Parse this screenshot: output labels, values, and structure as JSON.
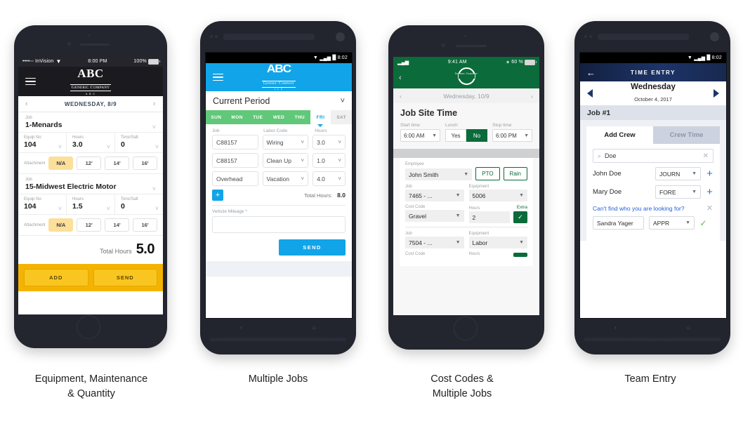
{
  "captions": [
    {
      "line1": "Equipment, Maintenance",
      "line2": "& Quantity"
    },
    {
      "line1": "Multiple Jobs",
      "line2": ""
    },
    {
      "line1": "Cost Codes &",
      "line2": "Multiple Jobs"
    },
    {
      "line1": "Team Entry",
      "line2": ""
    }
  ],
  "phone1": {
    "status": {
      "carrier": "••••◦◦ InVision",
      "wifi": "▼",
      "time": "8:00 PM",
      "battery_pct": "100%"
    },
    "logo": {
      "main": "ABC",
      "sub": "Generic Company",
      "sub2": "A B C"
    },
    "daybar": {
      "prev": "‹",
      "label": "WEDNESDAY, 8/9",
      "next": "›"
    },
    "jobs": [
      {
        "job_label": "Job",
        "job_value": "1-Menards",
        "fields": [
          {
            "label": "Equip No",
            "value": "104"
          },
          {
            "label": "Hours",
            "value": "3.0"
          },
          {
            "label": "Tons/Salt",
            "value": "0"
          }
        ],
        "attachment_label": "Attachment",
        "attachments": [
          "N/A",
          "12'",
          "14'",
          "16'"
        ],
        "attachment_selected": "N/A"
      },
      {
        "job_label": "Job",
        "job_value": "15-Midwest Electric Motor",
        "fields": [
          {
            "label": "Equip No",
            "value": "104"
          },
          {
            "label": "Hours",
            "value": "1.5"
          },
          {
            "label": "Tons/Salt",
            "value": "0"
          }
        ],
        "attachment_label": "Attachment",
        "attachments": [
          "N/A",
          "12'",
          "14'",
          "16'"
        ],
        "attachment_selected": "N/A"
      }
    ],
    "total_label": "Total Hours",
    "total_value": "5.0",
    "buttons": {
      "add": "ADD",
      "send": "SEND"
    },
    "colors": {
      "header": "#1b1b1f",
      "footer": "#f5b301",
      "chip_selected": "#fbdf9a"
    }
  },
  "phone2": {
    "status": {
      "wifi": "▼",
      "signal": "▂▄▆",
      "battery": "█",
      "time": "8:02"
    },
    "logo": {
      "main": "ABC",
      "sub": "Generic Company",
      "sub2": "L L C"
    },
    "period": {
      "label": "Current Period",
      "caret": "⌄"
    },
    "days": [
      {
        "label": "SUN",
        "state": "normal"
      },
      {
        "label": "MON",
        "state": "normal"
      },
      {
        "label": "TUE",
        "state": "normal"
      },
      {
        "label": "WED",
        "state": "normal"
      },
      {
        "label": "THU",
        "state": "normal"
      },
      {
        "label": "FRI",
        "state": "selected"
      },
      {
        "label": "SAT",
        "state": "disabled"
      }
    ],
    "columns": [
      "Job",
      "Labor Code",
      "Hours"
    ],
    "rows": [
      {
        "job": "C88157",
        "labor_code": "Wiring",
        "hours": "3.0"
      },
      {
        "job": "C88157",
        "labor_code": "Clean Up",
        "hours": "1.0"
      },
      {
        "job": "Overhead",
        "labor_code": "Vacation",
        "hours": "4.0"
      }
    ],
    "add_row_label": "+",
    "total_label": "Total Hours:",
    "total_value": "8.0",
    "mileage_label": "Vehicle Mileage *",
    "mileage_value": "",
    "send_label": "SEND",
    "colors": {
      "header": "#11a4e8",
      "day_bar": "#60c878",
      "accent": "#11a4e8"
    }
  },
  "phone3": {
    "status": {
      "signal": "▂▄▆",
      "time": "9:41 AM",
      "bluetooth": "✶",
      "battery_pct": "60 %"
    },
    "back": "‹",
    "logo_text": "Generic Company",
    "daybar": {
      "prev": "‹",
      "label": "Wednesday, 10/9",
      "next": "›"
    },
    "section_title": "Job Site Time",
    "time_fields": [
      {
        "label": "Start time",
        "value": "6:00 AM"
      },
      {
        "label": "Lunch",
        "options": [
          "Yes",
          "No"
        ],
        "selected": "No"
      },
      {
        "label": "Stop time",
        "value": "6:00 PM"
      }
    ],
    "entry": {
      "employee_label": "Employee",
      "employee_value": "John Smith",
      "pto_label": "PTO",
      "rain_label": "Rain",
      "job_label": "Job",
      "job_value": "7465 - ...",
      "equipment_label": "Equipment",
      "equipment_value": "5006",
      "cost_code_label": "Cost Code",
      "cost_code_value": "Gravel",
      "hours_label": "Hours",
      "hours_value": "2",
      "extra_label": "Extra",
      "extra_checked": "✓"
    },
    "entry2": {
      "job_label": "Job",
      "job_value": "7504 - ...",
      "equipment_label": "Equipment",
      "equipment_value": "Labor",
      "cost_code_label": "Cost Code",
      "hours_label": "Hours"
    },
    "colors": {
      "header": "#0b6b3a",
      "accent": "#0b6b3a"
    }
  },
  "phone4": {
    "status": {
      "wifi": "▼",
      "signal": "▂▄▆",
      "battery": "█",
      "time": "8:02"
    },
    "back": "←",
    "title": "TIME ENTRY",
    "day": {
      "name": "Wednesday",
      "date": "October 4, 2017"
    },
    "job_label": "Job #1",
    "tabs": [
      {
        "label": "Add Crew",
        "state": "active"
      },
      {
        "label": "Crew Time",
        "state": "inactive"
      }
    ],
    "search": {
      "icon": "⌕",
      "value": "Doe",
      "clear": "✕"
    },
    "crew": [
      {
        "name": "John Doe",
        "role": "JOURN",
        "action": "+"
      },
      {
        "name": "Mary Doe",
        "role": "FORE",
        "action": "+"
      }
    ],
    "not_found_text": "Can't find who you are looking for?",
    "not_found_dismiss": "✕",
    "new_entry": {
      "name": "Sandra Yager",
      "role": "APPR",
      "confirm": "✓"
    },
    "colors": {
      "header": "#1d3468",
      "accent": "#1f6fe8",
      "job_bar": "#dde1ea"
    }
  }
}
